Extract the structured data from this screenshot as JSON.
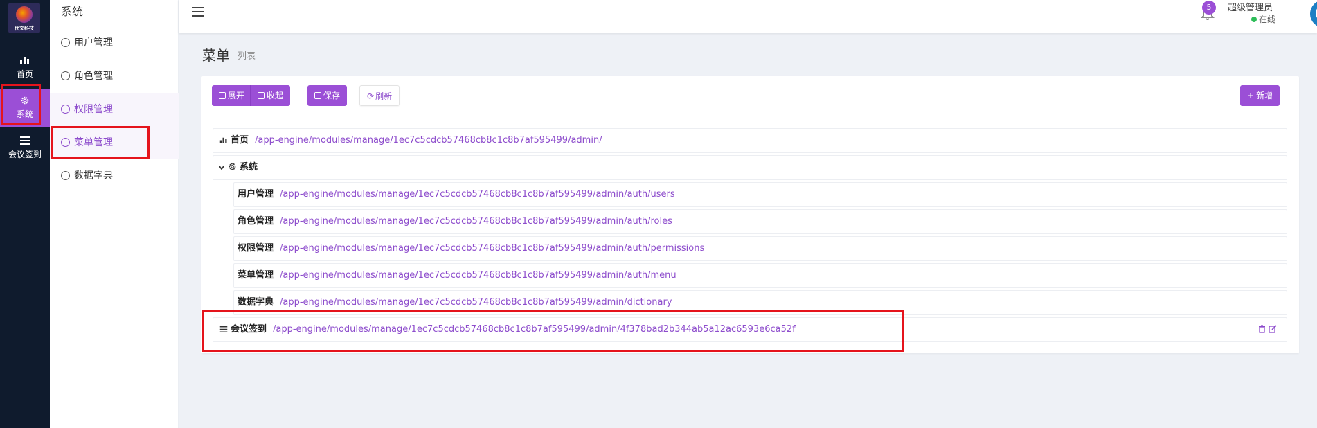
{
  "leftbar": {
    "logo_text": "代文科技",
    "items": [
      {
        "label": "首页"
      },
      {
        "label": "系统"
      },
      {
        "label": "会议签到"
      }
    ]
  },
  "submenu": {
    "title": "系统",
    "items": [
      {
        "label": "用户管理"
      },
      {
        "label": "角色管理"
      },
      {
        "label": "权限管理"
      },
      {
        "label": "菜单管理"
      },
      {
        "label": "数据字典"
      }
    ]
  },
  "header": {
    "notification_count": "5",
    "user_name": "超级管理员",
    "user_status": "在线"
  },
  "page": {
    "title": "菜单",
    "subtitle": "列表"
  },
  "toolbar": {
    "expand_label": "展开",
    "collapse_label": "收起",
    "save_label": "保存",
    "refresh_label": "刷新",
    "add_label": "新增"
  },
  "menu_tree": {
    "home": {
      "label": "首页",
      "path": "/app-engine/modules/manage/1ec7c5cdcb57468cb8c1c8b7af595499/admin/"
    },
    "system": {
      "label": "系统"
    },
    "children": [
      {
        "label": "用户管理",
        "path": "/app-engine/modules/manage/1ec7c5cdcb57468cb8c1c8b7af595499/admin/auth/users"
      },
      {
        "label": "角色管理",
        "path": "/app-engine/modules/manage/1ec7c5cdcb57468cb8c1c8b7af595499/admin/auth/roles"
      },
      {
        "label": "权限管理",
        "path": "/app-engine/modules/manage/1ec7c5cdcb57468cb8c1c8b7af595499/admin/auth/permissions"
      },
      {
        "label": "菜单管理",
        "path": "/app-engine/modules/manage/1ec7c5cdcb57468cb8c1c8b7af595499/admin/auth/menu"
      },
      {
        "label": "数据字典",
        "path": "/app-engine/modules/manage/1ec7c5cdcb57468cb8c1c8b7af595499/admin/dictionary"
      }
    ],
    "meeting": {
      "label": "会议签到",
      "path": "/app-engine/modules/manage/1ec7c5cdcb57468cb8c1c8b7af595499/admin/4f378bad2b344ab5a12ac6593e6ca52f"
    }
  },
  "colors": {
    "accent": "#9b4fd6",
    "link": "#8d4ccc",
    "sidebar_bg": "#0f1b2d",
    "highlight_border": "#e5141c",
    "online": "#2ebd59"
  }
}
